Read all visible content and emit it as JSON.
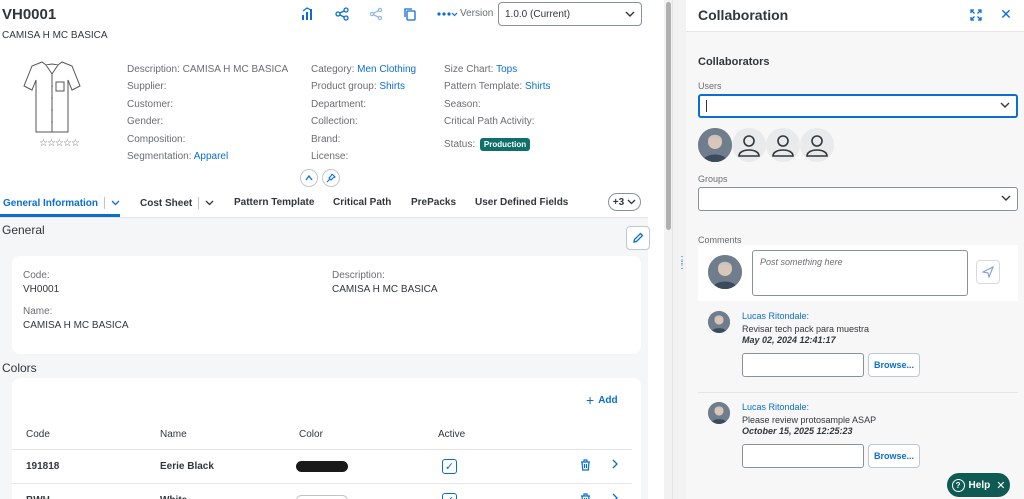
{
  "object": {
    "title": "VH0001",
    "subtitle": "CAMISA H MC BASICA",
    "version_label": "Version",
    "version_value": "1.0.0 (Current)",
    "rating": "☆☆☆☆☆",
    "attributes_col1": [
      {
        "label": "Description:",
        "value": "CAMISA H MC BASICA",
        "link": false
      },
      {
        "label": "Supplier:",
        "value": "",
        "link": false
      },
      {
        "label": "Customer:",
        "value": "",
        "link": false
      },
      {
        "label": "Gender:",
        "value": "",
        "link": false
      },
      {
        "label": "Composition:",
        "value": "",
        "link": false
      },
      {
        "label": "Segmentation:",
        "value": "Apparel",
        "link": true
      }
    ],
    "attributes_col2": [
      {
        "label": "Category:",
        "value": "Men Clothing",
        "link": true
      },
      {
        "label": "Product group:",
        "value": "Shirts",
        "link": true
      },
      {
        "label": "Department:",
        "value": "",
        "link": false
      },
      {
        "label": "Collection:",
        "value": "",
        "link": false
      },
      {
        "label": "Brand:",
        "value": "",
        "link": false
      },
      {
        "label": "License:",
        "value": "",
        "link": false
      }
    ],
    "attributes_col3": [
      {
        "label": "Size Chart:",
        "value": "Tops",
        "link": true
      },
      {
        "label": "Pattern Template:",
        "value": "Shirts",
        "link": true
      },
      {
        "label": "Season:",
        "value": "",
        "link": false
      },
      {
        "label": "Critical Path Activity:",
        "value": "",
        "link": false
      }
    ],
    "status_label": "Status:",
    "status_value": "Production"
  },
  "tabs": [
    {
      "label": "General Information",
      "active": true,
      "menu": true
    },
    {
      "label": "Cost Sheet",
      "active": false,
      "menu": true
    },
    {
      "label": "Pattern Template",
      "active": false,
      "menu": false
    },
    {
      "label": "Critical Path",
      "active": false,
      "menu": false
    },
    {
      "label": "PrePacks",
      "active": false,
      "menu": false
    },
    {
      "label": "User Defined Fields",
      "active": false,
      "menu": false
    }
  ],
  "more_tabs": "+3",
  "general": {
    "title": "General",
    "code_label": "Code:",
    "code_value": "VH0001",
    "description_label": "Description:",
    "description_value": "CAMISA H MC BASICA",
    "name_label": "Name:",
    "name_value": "CAMISA H MC BASICA"
  },
  "colors": {
    "title": "Colors",
    "add_label": "Add",
    "columns": [
      "Code",
      "Name",
      "Color",
      "Active"
    ],
    "rows": [
      {
        "code": "191818",
        "name": "Eerie Black",
        "swatch": "#1a1a1a",
        "active": true
      },
      {
        "code": "BWH",
        "name": "White",
        "swatch": "#ffffff",
        "active": true
      }
    ]
  },
  "collaboration": {
    "title": "Collaboration",
    "collaborators_title": "Collaborators",
    "users_label": "Users",
    "groups_label": "Groups",
    "comments_label": "Comments",
    "post_placeholder": "Post something here",
    "comments": [
      {
        "author": "Lucas Ritondale:",
        "text": "Revisar tech pack para muestra",
        "date": "May 02, 2024 12:41:17",
        "browse": "Browse..."
      },
      {
        "author": "Lucas Ritondale:",
        "text": "Please review protosample ASAP",
        "date": "October 15, 2025 12:25:23",
        "browse": "Browse..."
      }
    ]
  },
  "help_label": "Help",
  "colors_theme": {
    "accent": "#0a6ed1",
    "status": "#0f6f6a",
    "help": "#0f5a52"
  }
}
